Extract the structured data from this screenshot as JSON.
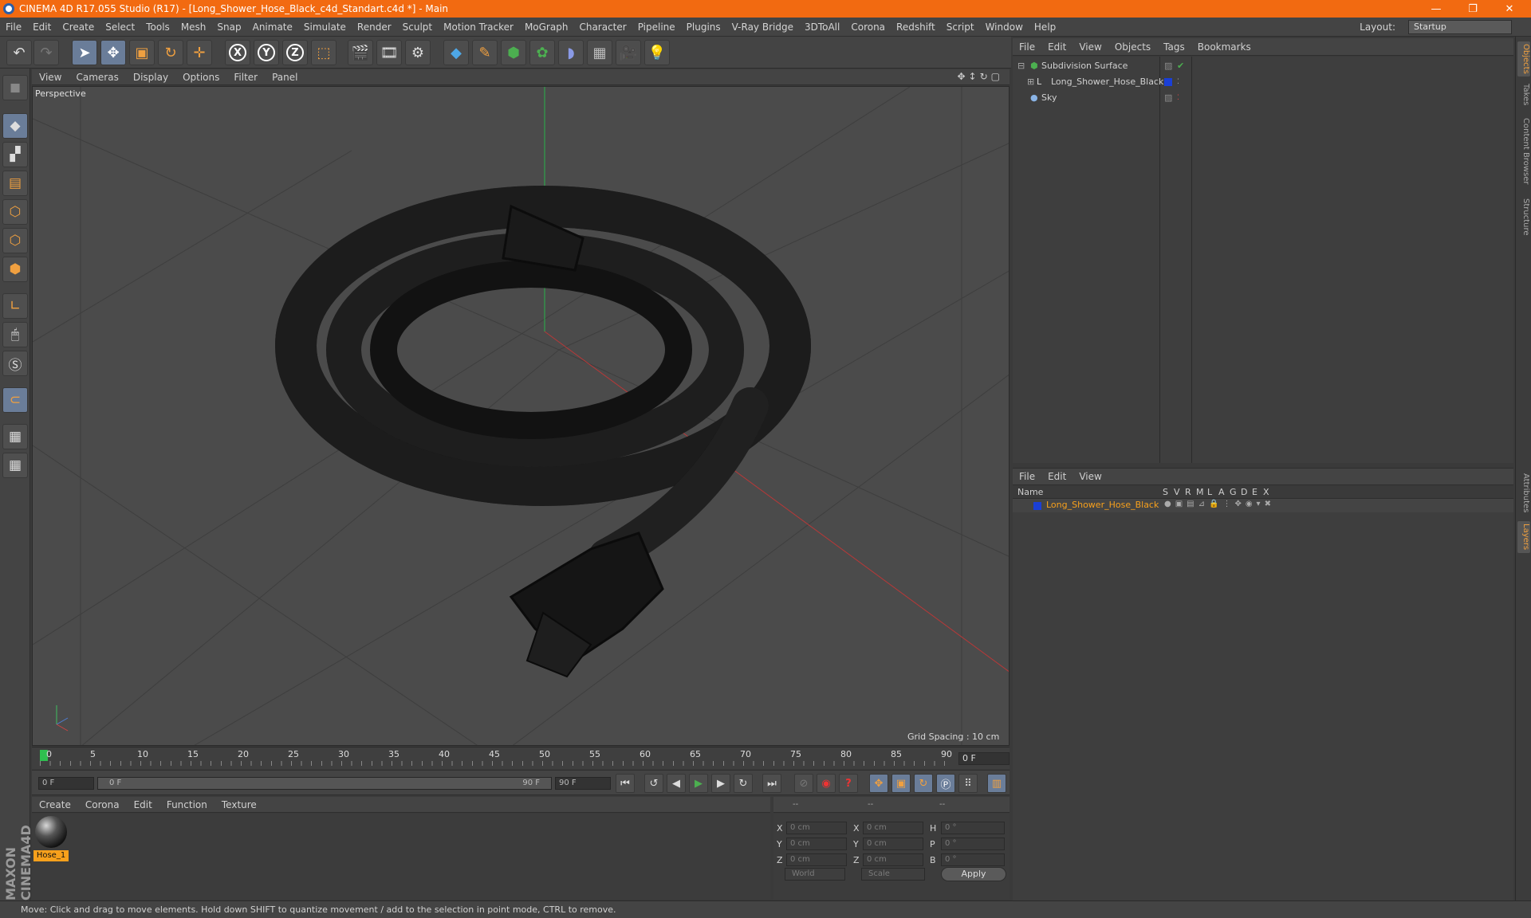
{
  "window": {
    "title": "CINEMA 4D R17.055 Studio (R17) - [Long_Shower_Hose_Black_c4d_Standart.c4d *] - Main",
    "minimize": "—",
    "maximize": "❐",
    "close": "✕"
  },
  "menubar": {
    "items": [
      "File",
      "Edit",
      "Create",
      "Select",
      "Tools",
      "Mesh",
      "Snap",
      "Animate",
      "Simulate",
      "Render",
      "Sculpt",
      "Motion Tracker",
      "MoGraph",
      "Character",
      "Pipeline",
      "Plugins",
      "V-Ray Bridge",
      "3DToAll",
      "Corona",
      "Redshift",
      "Script",
      "Window",
      "Help"
    ],
    "layout_label": "Layout:",
    "layout_value": "Startup"
  },
  "viewport": {
    "menu": [
      "View",
      "Cameras",
      "Display",
      "Options",
      "Filter",
      "Panel"
    ],
    "camera_label": "Perspective",
    "grid_spacing": "Grid Spacing : 10 cm"
  },
  "timeline": {
    "ticks": [
      "0",
      "5",
      "10",
      "15",
      "20",
      "25",
      "30",
      "35",
      "40",
      "45",
      "50",
      "55",
      "60",
      "65",
      "70",
      "75",
      "80",
      "85",
      "90"
    ],
    "current_frame": "0 F",
    "start_field": "0 F",
    "range_start": "0 F",
    "range_end": "90 F",
    "end_field": "90 F"
  },
  "materials": {
    "menu": [
      "Create",
      "Corona",
      "Edit",
      "Function",
      "Texture"
    ],
    "items": [
      {
        "name": "Hose_1"
      }
    ]
  },
  "coordinates": {
    "header": [
      "--",
      "--",
      "--"
    ],
    "rows": [
      {
        "axis1": "X",
        "v1": "0 cm",
        "axis2": "X",
        "v2": "0 cm",
        "axis3": "H",
        "v3": "0 °"
      },
      {
        "axis1": "Y",
        "v1": "0 cm",
        "axis2": "Y",
        "v2": "0 cm",
        "axis3": "P",
        "v3": "0 °"
      },
      {
        "axis1": "Z",
        "v1": "0 cm",
        "axis2": "Z",
        "v2": "0 cm",
        "axis3": "B",
        "v3": "0 °"
      }
    ],
    "world": "World",
    "scale": "Scale",
    "apply": "Apply"
  },
  "object_manager": {
    "menu": [
      "File",
      "Edit",
      "View",
      "Objects",
      "Tags",
      "Bookmarks"
    ],
    "objects": [
      {
        "name": "Subdivision Surface",
        "icon": "subdivision-icon"
      },
      {
        "name": "Long_Shower_Hose_Black",
        "icon": "null-object-icon",
        "color": "#1a3fd6"
      },
      {
        "name": "Sky",
        "icon": "sky-icon"
      }
    ]
  },
  "layer_manager": {
    "menu": [
      "File",
      "Edit",
      "View"
    ],
    "columns": [
      "Name",
      "S",
      "V",
      "R",
      "M",
      "L",
      "A",
      "G",
      "D",
      "E",
      "X"
    ],
    "layers": [
      {
        "name": "Long_Shower_Hose_Black",
        "color": "#1a3fd6"
      }
    ]
  },
  "side_tabs": [
    "Objects",
    "Takes",
    "Content Browser",
    "Structure",
    "Attributes",
    "Layers"
  ],
  "status": "Move: Click and drag to move elements. Hold down SHIFT to quantize movement / add to the selection in point mode, CTRL to remove.",
  "colors": {
    "accent": "#f26a11",
    "selection": "#f7a01c",
    "layer_blue": "#1a3fd6"
  }
}
